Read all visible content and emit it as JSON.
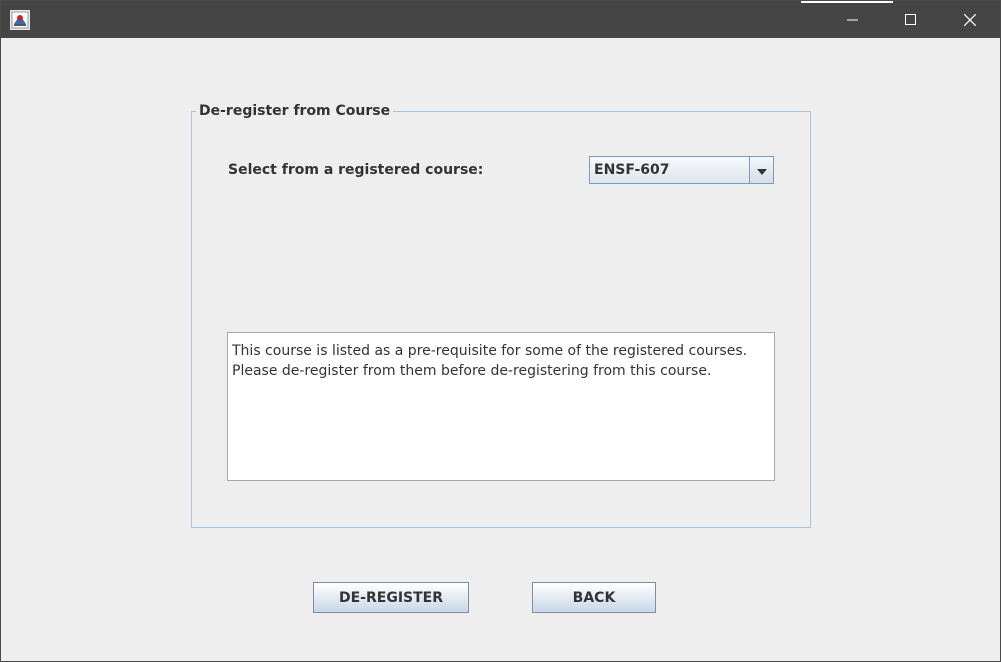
{
  "titlebar": {
    "icons": {
      "app": "java-app-icon",
      "minimize": "minimize-icon",
      "maximize": "maximize-icon",
      "close": "close-icon"
    }
  },
  "group": {
    "title": "De-register from Course"
  },
  "course_select": {
    "label": "Select from a registered course:",
    "selected": "ENSF-607",
    "arrow_icon": "chevron-down-icon"
  },
  "message": {
    "lines": [
      "This course is listed as a pre-requisite for some of the registered courses.",
      "Please de-register from them before de-registering from this course."
    ]
  },
  "buttons": {
    "deregister": "DE-REGISTER",
    "back": "BACK"
  },
  "colors": {
    "titlebar": "#454545",
    "window_bg": "#eeeeee",
    "group_border": "#a9c4dd",
    "text": "#333333"
  }
}
